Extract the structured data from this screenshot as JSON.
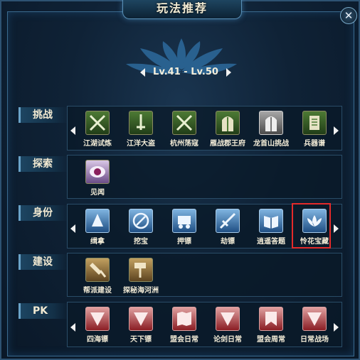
{
  "window": {
    "title": "玩法推荐",
    "close_glyph": "✕"
  },
  "level": {
    "range": "Lv.41 - Lv.50"
  },
  "categories": [
    {
      "label": "挑战",
      "items": [
        {
          "label": "江湖试炼",
          "icon": "crossed-swords-icon"
        },
        {
          "label": "江洋大盗",
          "icon": "sword-icon"
        },
        {
          "label": "杭州荡寇",
          "icon": "crossed-swords-icon"
        },
        {
          "label": "雁战郡王府",
          "icon": "gate-icon"
        },
        {
          "label": "龙首山挑战",
          "icon": "gate-icon"
        },
        {
          "label": "兵器谱",
          "icon": "scroll-icon"
        }
      ]
    },
    {
      "label": "探索",
      "items": [
        {
          "label": "见闻",
          "icon": "eye-icon"
        }
      ]
    },
    {
      "label": "身份",
      "items": [
        {
          "label": "缉拿",
          "icon": "arrest-icon"
        },
        {
          "label": "挖宝",
          "icon": "shovel-icon"
        },
        {
          "label": "押镖",
          "icon": "cart-icon"
        },
        {
          "label": "劫镖",
          "icon": "blade-icon"
        },
        {
          "label": "逍遥答题",
          "icon": "book-icon"
        },
        {
          "label": "怜花宝藏",
          "icon": "lotus-icon",
          "highlighted": true
        }
      ]
    },
    {
      "label": "建设",
      "items": [
        {
          "label": "帮派建设",
          "icon": "axe-icon"
        },
        {
          "label": "探秘海河洲",
          "icon": "hammer-icon"
        }
      ]
    },
    {
      "label": "PK",
      "items": [
        {
          "label": "四海镖",
          "icon": "pennant-icon"
        },
        {
          "label": "天下镖",
          "icon": "pennant-icon"
        },
        {
          "label": "盟会日常",
          "icon": "map-icon"
        },
        {
          "label": "论剑日常",
          "icon": "pennant-icon"
        },
        {
          "label": "盟会周常",
          "icon": "banner-icon"
        },
        {
          "label": "日常战场",
          "icon": "pennant-icon"
        }
      ]
    }
  ],
  "colors": {
    "highlight": "#e42a2a",
    "accent": "#6aa3c8"
  }
}
